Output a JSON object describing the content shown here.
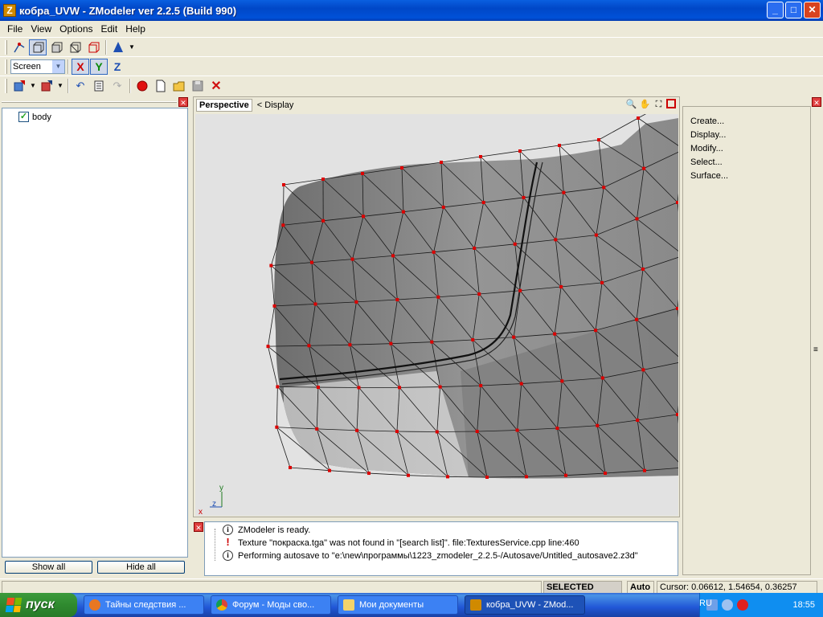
{
  "window": {
    "title": "кобра_UVW - ZModeler ver 2.2.5 (Build 990)",
    "app_icon_letter": "Z",
    "buttons": {
      "minimize": "_",
      "maximize": "□",
      "close": "✕"
    }
  },
  "menu": [
    {
      "label": "File"
    },
    {
      "label": "View"
    },
    {
      "label": "Options"
    },
    {
      "label": "Edit"
    },
    {
      "label": "Help"
    }
  ],
  "toolbar2": {
    "coordinate_system": "Screen",
    "axis_x": "X",
    "axis_y": "Y",
    "axis_z": "Z"
  },
  "left_panel": {
    "tree_items": [
      {
        "label": "body",
        "checked": true
      }
    ],
    "show_all": "Show all",
    "hide_all": "Hide all"
  },
  "viewport": {
    "view_name": "Perspective",
    "display_label": "< Display",
    "axis_gizmo": {
      "y": "y",
      "z": "z",
      "x": "x"
    }
  },
  "right_panel": {
    "items": [
      "Create...",
      "Display...",
      "Modify...",
      "Select...",
      "Surface..."
    ]
  },
  "log": [
    {
      "icon": "info",
      "text": "ZModeler is ready."
    },
    {
      "icon": "warning",
      "text": "Texture \"покраска.tga\" was not found in \"[search list]\". file:TexturesService.cpp line:460"
    },
    {
      "icon": "info",
      "text": "Performing autosave to \"e:\\new\\программы\\1223_zmodeler_2.2.5-/Autosave/Untitled_autosave2.z3d\""
    }
  ],
  "status": {
    "mode": "SELECTED MODE",
    "auto": "Auto",
    "cursor": "Cursor: 0.06612, 1.54654, 0.36257"
  },
  "taskbar": {
    "start_label": "пуск",
    "tasks": [
      {
        "label": "Тайны следствия ...",
        "icon_color": "#e87722"
      },
      {
        "label": "Форум - Моды сво...",
        "icon_color": "#3aa757"
      },
      {
        "label": "Мои документы",
        "icon_color": "#f3d36b"
      },
      {
        "label": "кобра_UVW - ZMod...",
        "icon_color": "#d08a00",
        "active": true
      }
    ],
    "language": "RU",
    "clock": "18:55"
  },
  "colors": {
    "titlebar": "#0054e3",
    "viewport_bg": "#e2e2e2",
    "mesh_fill": "#8a8a8a",
    "vertex": "#dd0000",
    "panel_bg": "#ece9d8"
  }
}
